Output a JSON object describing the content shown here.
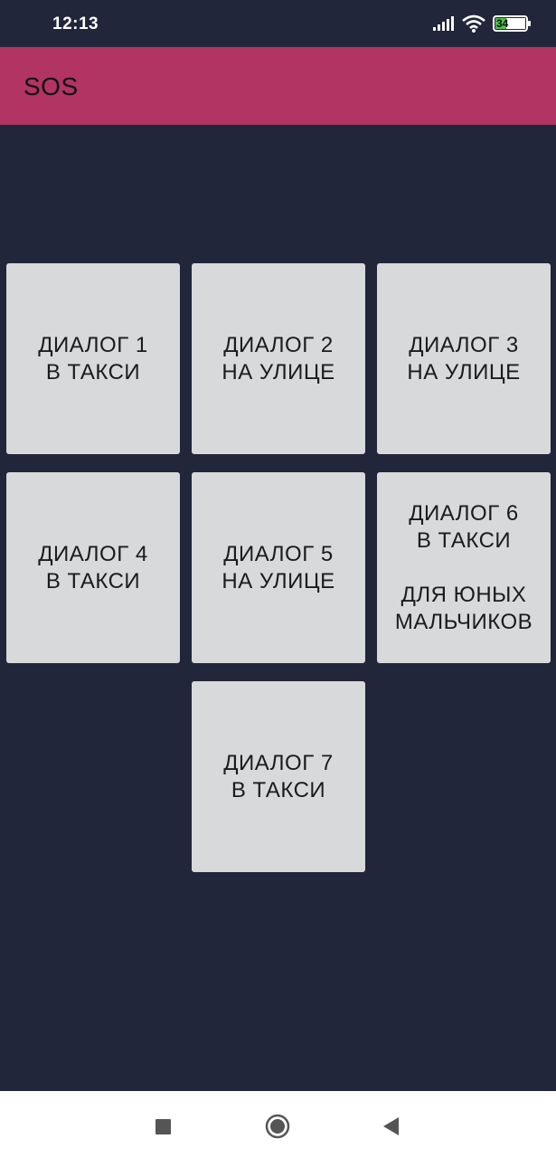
{
  "status_bar": {
    "time": "12:13",
    "battery_level": "34",
    "icons": [
      "signal-icon",
      "wifi-icon",
      "battery-icon"
    ]
  },
  "app_bar": {
    "title": "SOS",
    "color": "#b13462"
  },
  "tiles": [
    {
      "label": "ДИАЛОГ 1\nВ ТАКСИ"
    },
    {
      "label": "ДИАЛОГ 2\nНА УЛИЦЕ"
    },
    {
      "label": "ДИАЛОГ 3\nНА УЛИЦЕ"
    },
    {
      "label": "ДИАЛОГ 4\nВ ТАКСИ"
    },
    {
      "label": "ДИАЛОГ 5\nНА УЛИЦЕ"
    },
    {
      "label": "ДИАЛОГ 6\nВ ТАКСИ\n\nДЛЯ ЮНЫХ\nМАЛЬЧИКОВ"
    },
    {
      "label": "ДИАЛОГ 7\nВ ТАКСИ"
    }
  ],
  "nav_bar": {
    "icons": [
      "recents-square-icon",
      "home-circle-icon",
      "back-triangle-icon"
    ]
  },
  "colors": {
    "background": "#21263a",
    "tile": "#d7d9da"
  }
}
